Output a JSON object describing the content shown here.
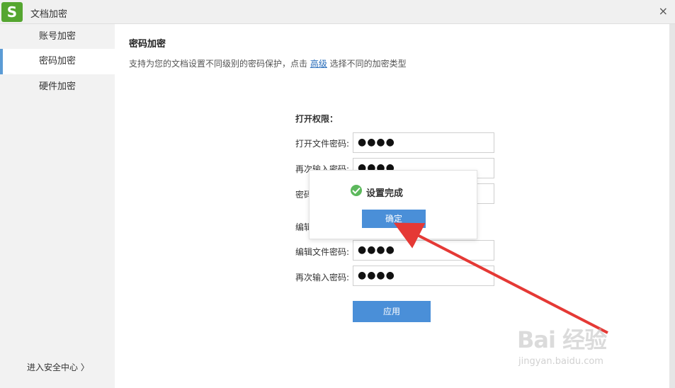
{
  "window": {
    "logo": "S",
    "title": "文档加密",
    "close": "×"
  },
  "sidebar": {
    "items": [
      {
        "label": "账号加密"
      },
      {
        "label": "密码加密"
      },
      {
        "label": "硬件加密"
      }
    ],
    "security_center": "进入安全中心 〉"
  },
  "main": {
    "section_title": "密码加密",
    "desc_before": "支持为您的文档设置不同级别的密码保护，点击 ",
    "desc_link": "高级",
    "desc_after": " 选择不同的加密类型",
    "open_group": {
      "label": "打开权限：",
      "fields": [
        {
          "label": "打开文件密码:",
          "value": "●●●●"
        },
        {
          "label": "再次输入密码:",
          "value": "●●●●"
        },
        {
          "label": "密码",
          "value": ""
        }
      ]
    },
    "edit_group": {
      "label": "编辑",
      "fields": [
        {
          "label": "编辑文件密码:",
          "value": "●●●●"
        },
        {
          "label": "再次输入密码:",
          "value": "●●●●"
        }
      ]
    },
    "apply_label": "应用"
  },
  "popup": {
    "message": "设置完成",
    "ok_label": "确定"
  },
  "watermark": {
    "text": "Bai 经验",
    "url": "jingyan.baidu.com"
  },
  "colors": {
    "accent": "#4a8fd8",
    "logo": "#55a630",
    "success": "#5cb85c",
    "arrow": "#e53935"
  }
}
